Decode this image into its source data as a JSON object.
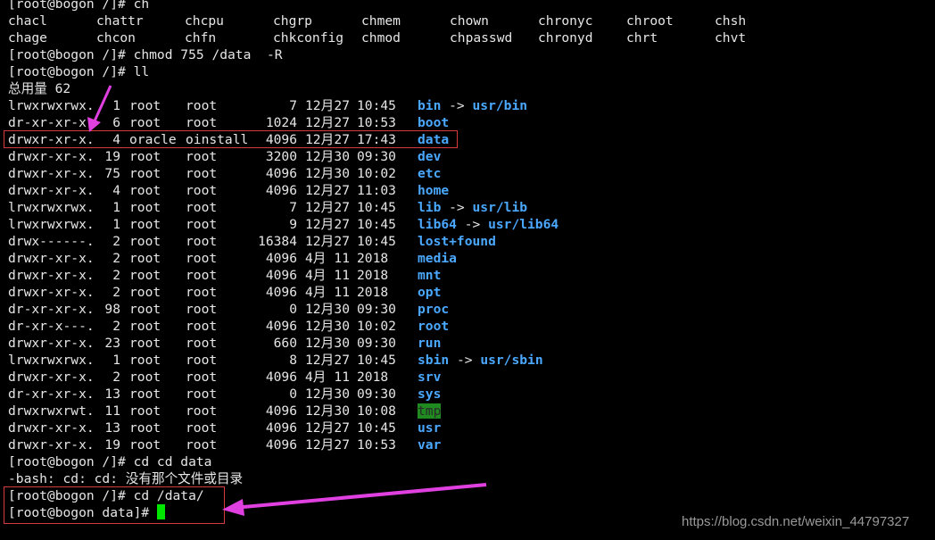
{
  "terminal": {
    "top_lines": [
      "[root@bogon /]# ch"
    ],
    "completions": [
      [
        "chacl",
        "chattr",
        "chcpu",
        "chgrp",
        "chmem",
        "chown",
        "chronyc",
        "chroot",
        "chsh"
      ],
      [
        "chage",
        "chcon",
        "chfn",
        "chkconfig",
        "chmod",
        "chpasswd",
        "chronyd",
        "chrt",
        "chvt"
      ]
    ],
    "cmd_chmod": "[root@bogon /]# chmod 755 /data  -R",
    "cmd_ll": "[root@bogon /]# ll",
    "total": "总用量 62",
    "listing": [
      {
        "perm": "lrwxrwxrwx.",
        "links": "1",
        "owner": "root",
        "group": "root",
        "size": "7",
        "month": "12月",
        "day": "27",
        "time": "10:45",
        "name": "bin",
        "type": "link",
        "target": "usr/bin"
      },
      {
        "perm": "dr-xr-xr-x.",
        "links": "6",
        "owner": "root",
        "group": "root",
        "size": "1024",
        "month": "12月",
        "day": "27",
        "time": "10:53",
        "name": "boot",
        "type": "dir",
        "target": ""
      },
      {
        "perm": "drwxr-xr-x.",
        "links": "4",
        "owner": "oracle",
        "group": "oinstall",
        "size": "4096",
        "month": "12月",
        "day": "27",
        "time": "17:43",
        "name": "data",
        "type": "dir",
        "target": ""
      },
      {
        "perm": "drwxr-xr-x.",
        "links": "19",
        "owner": "root",
        "group": "root",
        "size": "3200",
        "month": "12月",
        "day": "30",
        "time": "09:30",
        "name": "dev",
        "type": "dir",
        "target": ""
      },
      {
        "perm": "drwxr-xr-x.",
        "links": "75",
        "owner": "root",
        "group": "root",
        "size": "4096",
        "month": "12月",
        "day": "30",
        "time": "10:02",
        "name": "etc",
        "type": "dir",
        "target": ""
      },
      {
        "perm": "drwxr-xr-x.",
        "links": "4",
        "owner": "root",
        "group": "root",
        "size": "4096",
        "month": "12月",
        "day": "27",
        "time": "11:03",
        "name": "home",
        "type": "dir",
        "target": ""
      },
      {
        "perm": "lrwxrwxrwx.",
        "links": "1",
        "owner": "root",
        "group": "root",
        "size": "7",
        "month": "12月",
        "day": "27",
        "time": "10:45",
        "name": "lib",
        "type": "link",
        "target": "usr/lib"
      },
      {
        "perm": "lrwxrwxrwx.",
        "links": "1",
        "owner": "root",
        "group": "root",
        "size": "9",
        "month": "12月",
        "day": "27",
        "time": "10:45",
        "name": "lib64",
        "type": "link",
        "target": "usr/lib64"
      },
      {
        "perm": "drwx------.",
        "links": "2",
        "owner": "root",
        "group": "root",
        "size": "16384",
        "month": "12月",
        "day": "27",
        "time": "10:45",
        "name": "lost+found",
        "type": "dir",
        "target": ""
      },
      {
        "perm": "drwxr-xr-x.",
        "links": "2",
        "owner": "root",
        "group": "root",
        "size": "4096",
        "month": "4月",
        "day": "11",
        "time": "2018",
        "name": "media",
        "type": "dir",
        "target": ""
      },
      {
        "perm": "drwxr-xr-x.",
        "links": "2",
        "owner": "root",
        "group": "root",
        "size": "4096",
        "month": "4月",
        "day": "11",
        "time": "2018",
        "name": "mnt",
        "type": "dir",
        "target": ""
      },
      {
        "perm": "drwxr-xr-x.",
        "links": "2",
        "owner": "root",
        "group": "root",
        "size": "4096",
        "month": "4月",
        "day": "11",
        "time": "2018",
        "name": "opt",
        "type": "dir",
        "target": ""
      },
      {
        "perm": "dr-xr-xr-x.",
        "links": "98",
        "owner": "root",
        "group": "root",
        "size": "0",
        "month": "12月",
        "day": "30",
        "time": "09:30",
        "name": "proc",
        "type": "dir",
        "target": ""
      },
      {
        "perm": "dr-xr-x---.",
        "links": "2",
        "owner": "root",
        "group": "root",
        "size": "4096",
        "month": "12月",
        "day": "30",
        "time": "10:02",
        "name": "root",
        "type": "dir",
        "target": ""
      },
      {
        "perm": "drwxr-xr-x.",
        "links": "23",
        "owner": "root",
        "group": "root",
        "size": "660",
        "month": "12月",
        "day": "30",
        "time": "09:30",
        "name": "run",
        "type": "dir",
        "target": ""
      },
      {
        "perm": "lrwxrwxrwx.",
        "links": "1",
        "owner": "root",
        "group": "root",
        "size": "8",
        "month": "12月",
        "day": "27",
        "time": "10:45",
        "name": "sbin",
        "type": "link",
        "target": "usr/sbin"
      },
      {
        "perm": "drwxr-xr-x.",
        "links": "2",
        "owner": "root",
        "group": "root",
        "size": "4096",
        "month": "4月",
        "day": "11",
        "time": "2018",
        "name": "srv",
        "type": "dir",
        "target": ""
      },
      {
        "perm": "dr-xr-xr-x.",
        "links": "13",
        "owner": "root",
        "group": "root",
        "size": "0",
        "month": "12月",
        "day": "30",
        "time": "09:30",
        "name": "sys",
        "type": "dir",
        "target": ""
      },
      {
        "perm": "drwxrwxrwt.",
        "links": "11",
        "owner": "root",
        "group": "root",
        "size": "4096",
        "month": "12月",
        "day": "30",
        "time": "10:08",
        "name": "tmp",
        "type": "tmp",
        "target": ""
      },
      {
        "perm": "drwxr-xr-x.",
        "links": "13",
        "owner": "root",
        "group": "root",
        "size": "4096",
        "month": "12月",
        "day": "27",
        "time": "10:45",
        "name": "usr",
        "type": "dir",
        "target": ""
      },
      {
        "perm": "drwxr-xr-x.",
        "links": "19",
        "owner": "root",
        "group": "root",
        "size": "4096",
        "month": "12月",
        "day": "27",
        "time": "10:53",
        "name": "var",
        "type": "dir",
        "target": ""
      }
    ],
    "link_arrow": "->",
    "cmd_cd_bad": "[root@bogon /]# cd cd data",
    "err_cd": "-bash: cd: cd: 没有那个文件或目录",
    "cmd_cd_data": "[root@bogon /]# cd /data/",
    "prompt_data": "[root@bogon data]# "
  },
  "watermark": "https://blog.csdn.net/weixin_44797327",
  "colors": {
    "background": "#000000",
    "text": "#e6e6e6",
    "directory": "#4aa8ff",
    "tmp_bg": "#1f8a1f",
    "cursor": "#00e600",
    "highlight_box": "#d63a3a",
    "annotation_arrow": "#e040e0"
  }
}
